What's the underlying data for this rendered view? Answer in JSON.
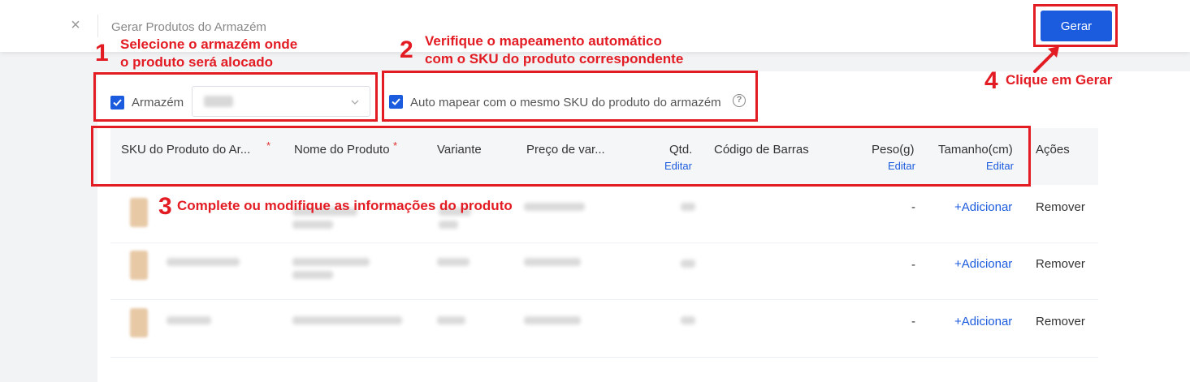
{
  "header": {
    "title": "Gerar Produtos do Armazém",
    "generate_label": "Gerar"
  },
  "filters": {
    "warehouse_label": "Armazém",
    "warehouse_checked": true,
    "auto_map_label": "Auto mapear com o mesmo SKU do produto do armazém",
    "auto_map_checked": true,
    "help_glyph": "?"
  },
  "table": {
    "columns": {
      "sku": "SKU do Produto do Ar...",
      "name": "Nome do Produto",
      "variant": "Variante",
      "price": "Preço de var...",
      "qty": "Qtd.",
      "barcode": "Código de Barras",
      "weight": "Peso(g)",
      "size": "Tamanho(cm)",
      "actions": "Ações"
    },
    "required_mark": "*",
    "edit_label": "Editar",
    "rows": [
      {
        "weight": "-",
        "size_action": "+Adicionar",
        "remove": "Remover"
      },
      {
        "weight": "-",
        "size_action": "+Adicionar",
        "remove": "Remover"
      },
      {
        "weight": "-",
        "size_action": "+Adicionar",
        "remove": "Remover"
      }
    ]
  },
  "annotations": {
    "step1": {
      "num": "1",
      "line1": "Selecione o armazém onde",
      "line2": "o produto será alocado"
    },
    "step2": {
      "num": "2",
      "line1": "Verifique o mapeamento automático",
      "line2": "com o SKU do produto correspondente"
    },
    "step3": {
      "num": "3",
      "text": "Complete ou modifique as informações do produto"
    },
    "step4": {
      "num": "4",
      "text": "Clique em Gerar"
    },
    "color": "#e31b23"
  },
  "colors": {
    "accent": "#1b5bde",
    "required": "#e0312a"
  }
}
